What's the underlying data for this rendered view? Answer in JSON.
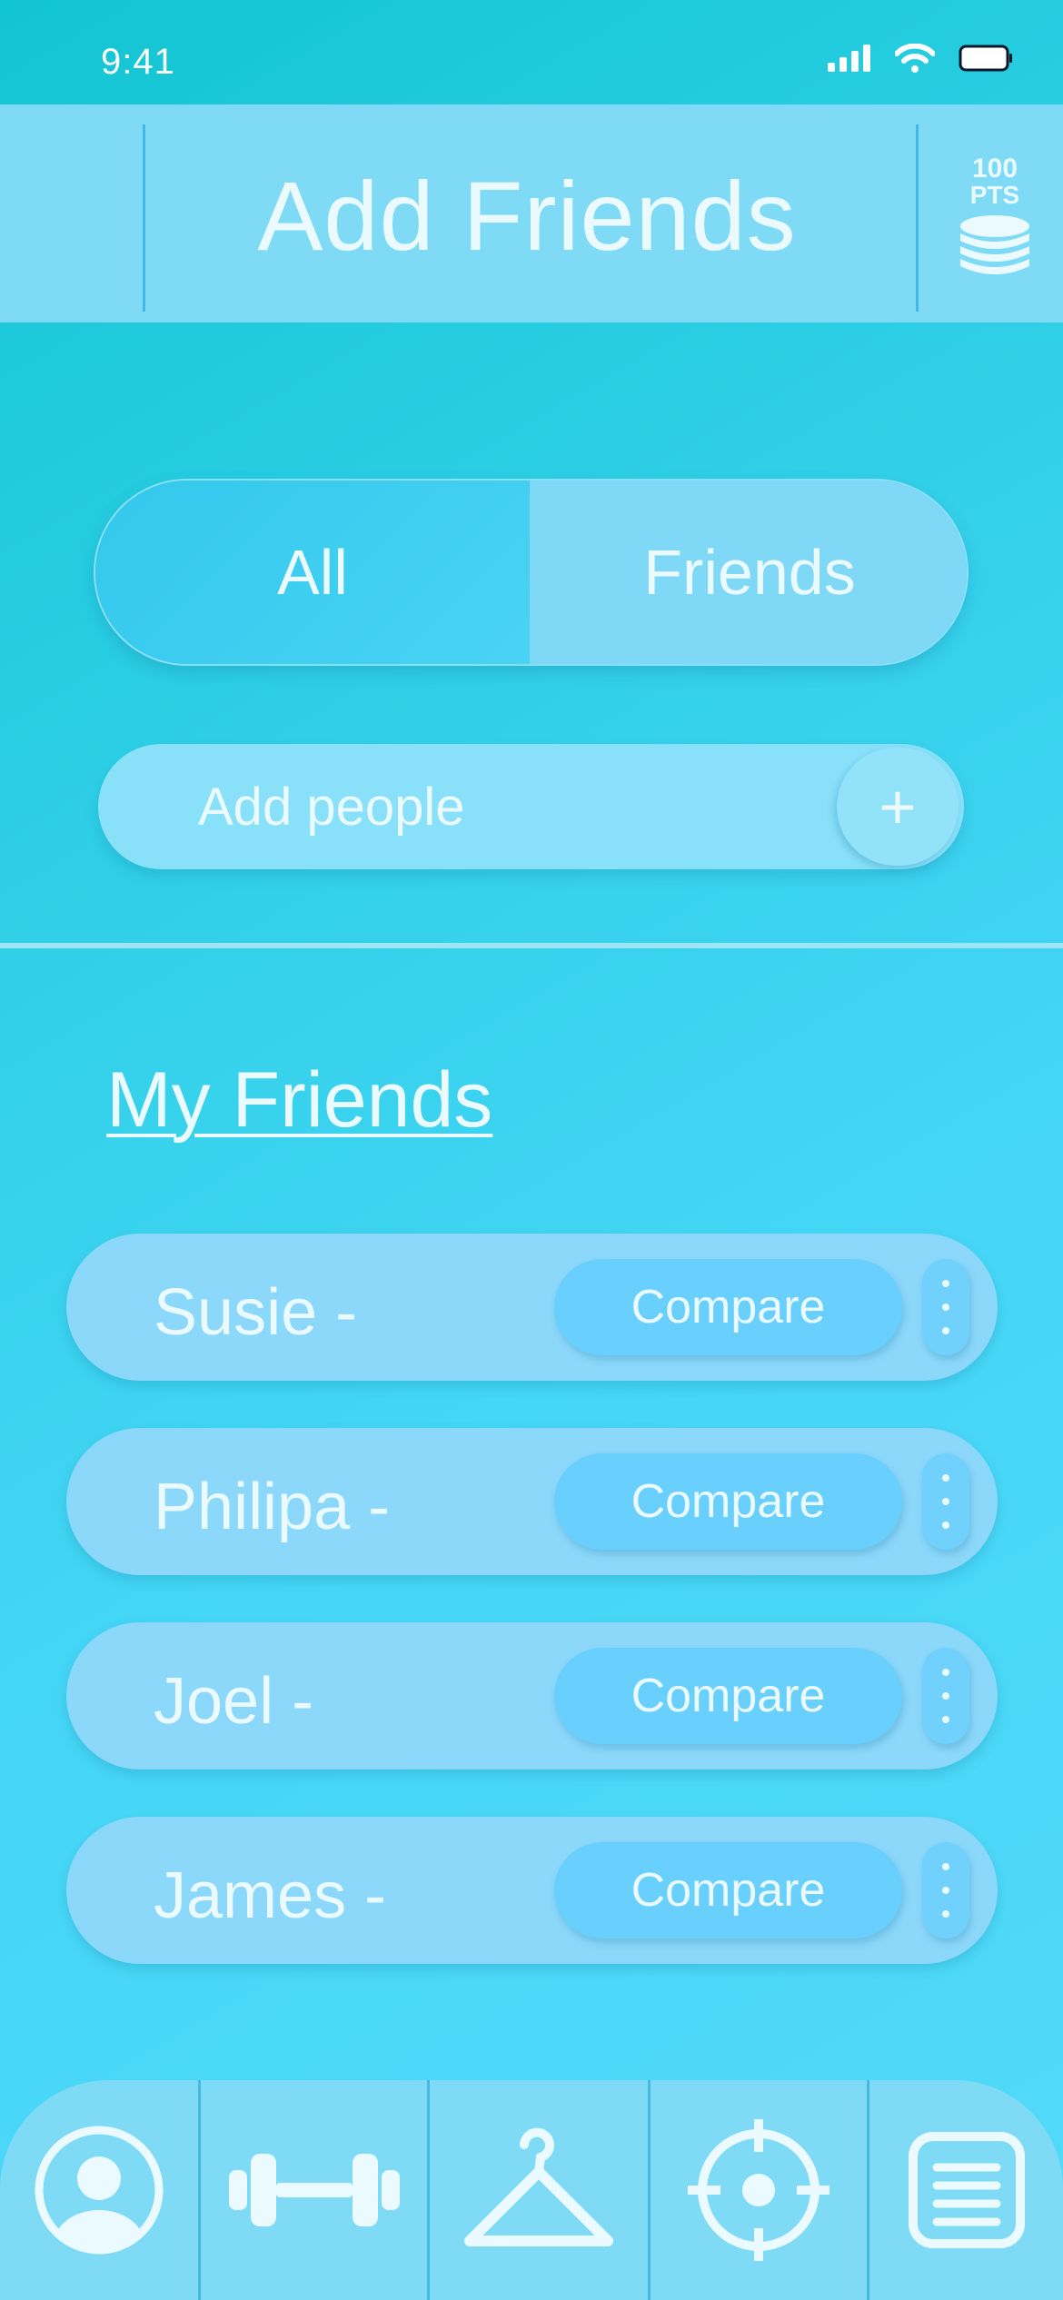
{
  "status_bar": {
    "time": "9:41"
  },
  "header": {
    "title": "Add Friends",
    "points_value": "100",
    "points_unit": "PTS"
  },
  "segmented_control": {
    "options": [
      "All",
      "Friends"
    ],
    "selected": "All"
  },
  "add_people": {
    "placeholder": "Add people",
    "button_label": "+"
  },
  "friends_section": {
    "title": "My Friends",
    "action_label": "Compare",
    "friends": [
      {
        "name": "Susie -"
      },
      {
        "name": "Philipa -"
      },
      {
        "name": "Joel -"
      },
      {
        "name": "James -"
      }
    ]
  },
  "tab_bar": {
    "items": [
      "profile-icon",
      "dumbbell-icon",
      "hanger-icon",
      "target-icon",
      "notes-icon"
    ]
  },
  "colors": {
    "background_start": "#12c5d2",
    "background_end": "#52daf9",
    "panel": "#7fdaf6",
    "row": "#8cd8fb",
    "button": "#69cffd",
    "text": "#eafaff"
  }
}
